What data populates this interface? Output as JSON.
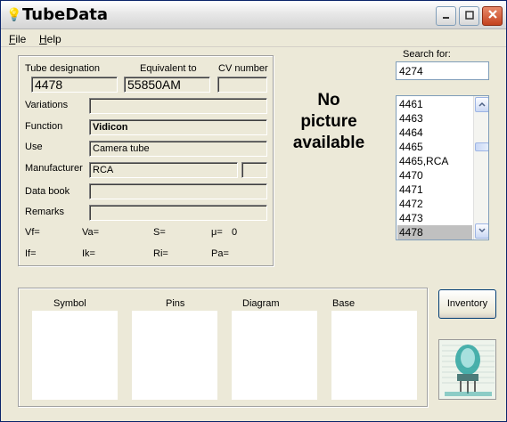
{
  "window": {
    "title": "TubeData"
  },
  "menu": {
    "file": "File",
    "file_u": "F",
    "file_rest": "ile",
    "help": "Help",
    "help_u": "H",
    "help_rest": "elp"
  },
  "details": {
    "tube_designation_label": "Tube designation",
    "tube_designation": "4478",
    "equivalent_label": "Equivalent to",
    "equivalent": "55850AM",
    "cv_label": "CV number",
    "cv": "",
    "variations_label": "Variations",
    "variations": "",
    "function_label": "Function",
    "function": "Vidicon",
    "use_label": "Use",
    "use": "Camera tube",
    "manufacturer_label": "Manufacturer",
    "manufacturer": "RCA",
    "manufacturer_extra": "",
    "databook_label": "Data book",
    "databook": "",
    "remarks_label": "Remarks",
    "remarks": ""
  },
  "params": {
    "vf": "Vf=",
    "va": "Va=",
    "s": "S=",
    "mu": "μ=",
    "mu_value": "0",
    "if": "If=",
    "ik": "Ik=",
    "ri": "Ri=",
    "pa": "Pa="
  },
  "picture": {
    "line1": "No",
    "line2": "picture",
    "line3": "available"
  },
  "search": {
    "label": "Search for:",
    "value": "4274"
  },
  "list": {
    "items": [
      "4461",
      "4463",
      "4464",
      "4465",
      "4465,RCA",
      "4470",
      "4471",
      "4472",
      "4473",
      "4478"
    ],
    "selected": "4478"
  },
  "images": {
    "symbol": "Symbol",
    "pins": "Pins",
    "diagram": "Diagram",
    "base": "Base"
  },
  "buttons": {
    "inventory": "Inventory"
  },
  "colors": {
    "title_close": "#c4421f",
    "selection": "#c0c0c0",
    "logo_teal": "#2aa3a0"
  }
}
